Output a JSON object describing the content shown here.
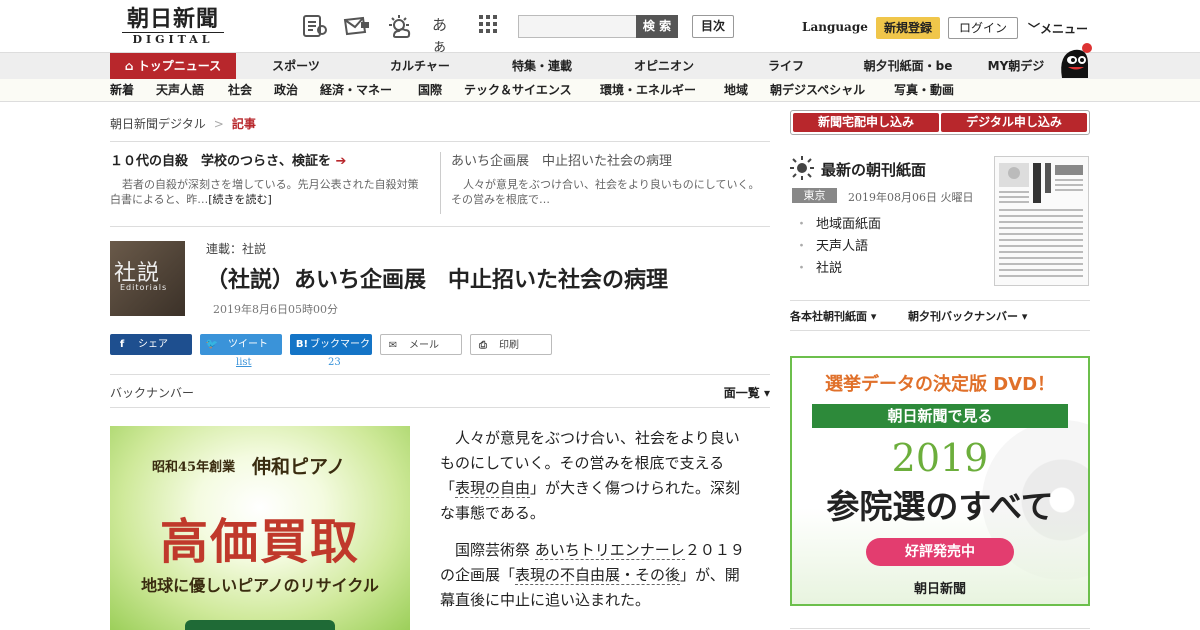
{
  "header": {
    "logo_jp": "朝日新聞",
    "logo_en": "DIGITAL",
    "font_label": "あぁ",
    "search_placeholder": "",
    "search_button": "検 索",
    "toc_button": "目次",
    "language": "Language",
    "register": "新規登録",
    "login": "ログイン",
    "menu": "メニュー",
    "icons": [
      "paper-icon",
      "mail-icon",
      "weather-icon",
      "font-size-icon",
      "grid-icon"
    ]
  },
  "nav_primary": [
    "トップニュース",
    "スポーツ",
    "カルチャー",
    "特集・連載",
    "オピニオン",
    "ライフ",
    "朝夕刊紙面・be",
    "MY朝デジ"
  ],
  "nav_secondary": [
    "新着",
    "天声人語",
    "社会",
    "政治",
    "経済・マネー",
    "国際",
    "テック＆サイエンス",
    "環境・エネルギー",
    "地域",
    "朝デジスペシャル",
    "写真・動画"
  ],
  "breadcrumb": {
    "home": "朝日新聞デジタル",
    "sep": ">",
    "current": "記事"
  },
  "related": [
    {
      "title": "１０代の自殺　学校のつらさ、検証を",
      "desc": "若者の自殺が深刻さを増している。先月公表された自殺対策白書によると、昨…",
      "more": "[続きを読む]"
    },
    {
      "title": "あいち企画展　中止招いた社会の病理",
      "desc": "人々が意見をぶつけ合い、社会をより良いものにしていく。その営みを根底で…"
    }
  ],
  "article": {
    "thumb_kanji": "社説",
    "thumb_en": "Editorials",
    "series": "連載：社説",
    "title": "（社説）あいち企画展　中止招いた社会の病理",
    "date": "2019年8月6日05時00分"
  },
  "share": {
    "facebook": "シェア",
    "twitter": "ツイート",
    "twitter_count": "list",
    "hatena": "ブックマーク",
    "hatena_count": "23",
    "mail": "メール",
    "print": "印刷"
  },
  "backnumber": {
    "label": "バックナンバー",
    "list": "面一覧"
  },
  "ad_left": {
    "founded": "昭和45年創業",
    "brand": "伸和ピアノ",
    "headline": "高価買取",
    "sub": "地球に優しいピアノのリサイクル"
  },
  "body": {
    "p1_a": "人々が意見をぶつけ合い、社会をより良いものにしていく。その営みを根底で支える「",
    "p1_kw": "表現の自由",
    "p1_b": "」が大きく傷つけられた。深刻な事態である。",
    "p2_a": "国際芸術祭",
    "p2_kw1": "あいちトリエンナーレ",
    "p2_b": "２０１９の企画展「",
    "p2_kw2": "表現の不自由展・その後",
    "p2_c": "」が、開幕直後に中止に追い込まれた。"
  },
  "sidebar": {
    "apply_home": "新聞宅配申し込み",
    "apply_digital": "デジタル申し込み",
    "morning_title": "最新の朝刊紙面",
    "region": "東京",
    "paper_date": "2019年08月06日 火曜日",
    "links": [
      "地域面紙面",
      "天声人語",
      "社説"
    ],
    "select_papers": "各本社朝刊紙面",
    "select_backnumber": "朝夕刊バックナンバー"
  },
  "ad_right": {
    "head": "選挙データの決定版 DVD！",
    "band": "朝日新聞で見る",
    "year": "2019",
    "title": "参院選のすべて",
    "sale": "好評発売中",
    "logo": "朝日新聞"
  },
  "colors": {
    "brand_red": "#b8272c",
    "register_yellow": "#f0c64a",
    "ad_green": "#6cbf4c"
  }
}
